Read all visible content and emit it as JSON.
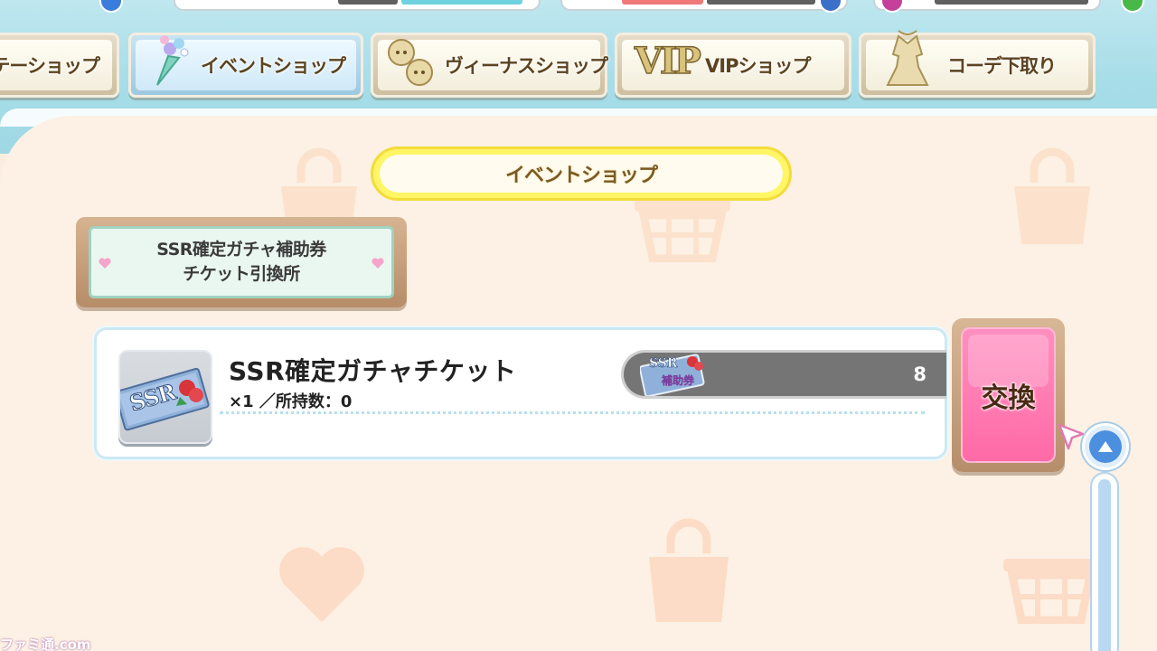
{
  "tabs": [
    {
      "label": "テーショップ",
      "icon": "dress-icon"
    },
    {
      "label": "イベントショップ",
      "icon": "bouquet-icon",
      "active": true
    },
    {
      "label": "ヴィーナスショップ",
      "icon": "venus-characters-icon"
    },
    {
      "label": "VIPショップ",
      "icon": "vip-icon",
      "badge": "VIP"
    },
    {
      "label": "コーデ下取り",
      "icon": "outfit-icon"
    }
  ],
  "shop_title": "イベントショップ",
  "sign": {
    "line1": "SSR確定ガチャ補助券",
    "line2": "チケット引換所"
  },
  "item": {
    "name": "SSR確定ガチャチケット",
    "quantity_text": "×1 ／所持数：0",
    "ticket_text": "SSR",
    "cost_icon_top": "SSR",
    "cost_icon_bottom": "補助券",
    "cost": "8"
  },
  "exchange_label": "交換",
  "watermark": "ファミ通.com",
  "colors": {
    "exchange": "#ff6aa6",
    "title_border": "#f3dc3b",
    "scroll": "#4b8fde"
  }
}
